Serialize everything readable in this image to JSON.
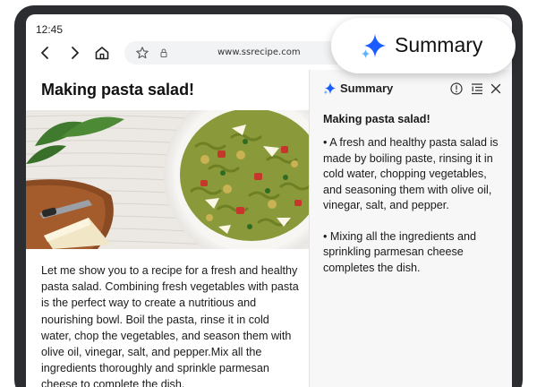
{
  "status_bar": {
    "time": "12:45"
  },
  "browser": {
    "url": "www.ssrecipe.com",
    "icons": [
      "back-arrow-icon",
      "forward-arrow-icon",
      "home-icon",
      "star-icon",
      "lock-icon"
    ]
  },
  "article": {
    "title": "Making pasta salad!",
    "body": "Let me show you to a recipe for a fresh and healthy pasta salad. Combining fresh vegetables with pasta is the perfect way to create a nutritious and nourishing bowl. Boil the pasta, rinse it in cold water, chop the vegetables, and season them with olive oil, vinegar, salt, and pepper.Mix all the ingredients thoroughly and sprinkle parmesan cheese to complete the dish."
  },
  "summary_panel": {
    "title": "Summary",
    "heading": "Making pasta salad!",
    "bullets": [
      "• A fresh and healthy pasta salad is made by boiling paste, rinsing it in cold water, chopping vegetables, and seasoning them with olive oil, vinegar, salt, and pepper.",
      "• Mixing all the ingredients and sprinkling parmesan cheese completes the dish."
    ],
    "icons": [
      "sparkle-icon",
      "info-icon",
      "list-format-icon",
      "close-icon"
    ]
  },
  "summary_pill": {
    "label": "Summary",
    "icon": "sparkle-icon"
  },
  "colors": {
    "frame": "#2b2d31",
    "sparkle_dark": "#1a5cff",
    "sparkle_light": "#5fb2ff",
    "panel_bg": "#f7f7f7",
    "urlbar_bg": "#f1f3f4"
  }
}
